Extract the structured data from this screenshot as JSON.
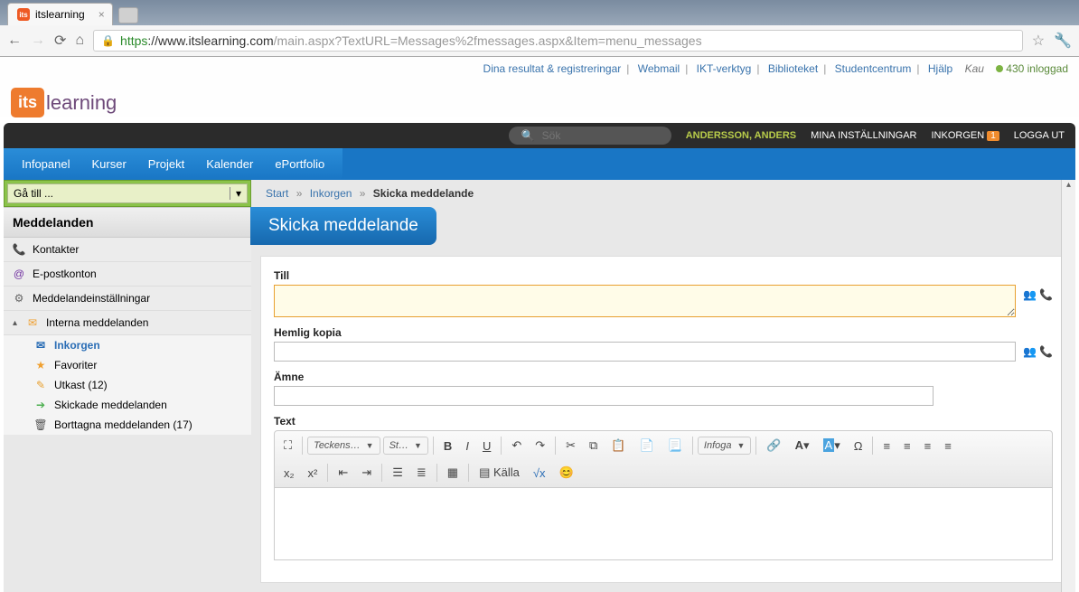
{
  "browser": {
    "tab_title": "itslearning",
    "tab_favicon": "its",
    "url_https": "https",
    "url_domain": "://www.itslearning.com",
    "url_path": "/main.aspx?TextURL=Messages%2fmessages.aspx&Item=menu_messages"
  },
  "toplinks": {
    "items": [
      "Dina resultat & registreringar",
      "Webmail",
      "IKT-verktyg",
      "Biblioteket",
      "Studentcentrum",
      "Hjälp"
    ],
    "kau": "Kau",
    "online": "430 inloggad"
  },
  "logo": {
    "box": "its",
    "text": "learning"
  },
  "blackbar": {
    "search_placeholder": "Sök",
    "user": "ANDERSSON, ANDERS",
    "settings": "MINA INSTÄLLNINGAR",
    "inbox": "INKORGEN",
    "inbox_badge": "1",
    "logout": "LOGGA UT"
  },
  "bluenav": [
    "Infopanel",
    "Kurser",
    "Projekt",
    "Kalender",
    "ePortfolio"
  ],
  "sidebar": {
    "goto": "Gå till ...",
    "header": "Meddelanden",
    "items": [
      {
        "label": "Kontakter",
        "icon": "contact"
      },
      {
        "label": "E-postkonton",
        "icon": "at"
      },
      {
        "label": "Meddelandeinställningar",
        "icon": "gear"
      }
    ],
    "group": "Interna meddelanden",
    "subs": [
      {
        "label": "Inkorgen",
        "icon": "mail-blue",
        "active": true
      },
      {
        "label": "Favoriter",
        "icon": "star"
      },
      {
        "label": "Utkast (12)",
        "icon": "pencil"
      },
      {
        "label": "Skickade meddelanden",
        "icon": "arrow"
      },
      {
        "label": "Borttagna meddelanden (17)",
        "icon": "trash"
      }
    ]
  },
  "breadcrumb": {
    "start": "Start",
    "inbox": "Inkorgen",
    "current": "Skicka meddelande"
  },
  "pagetitle": "Skicka meddelande",
  "form": {
    "to": "Till",
    "bcc": "Hemlig kopia",
    "subject": "Ämne",
    "text": "Text"
  },
  "editor": {
    "font": "Teckens…",
    "style": "St…",
    "insert": "Infoga",
    "source": "Källa"
  }
}
